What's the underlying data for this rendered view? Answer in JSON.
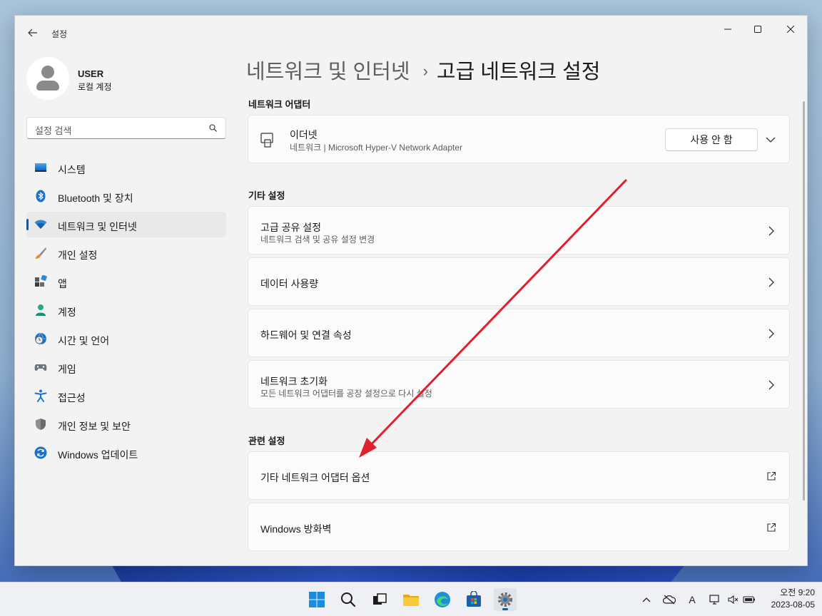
{
  "window": {
    "app_title": "설정"
  },
  "profile": {
    "name": "USER",
    "account_type": "로컬 계정"
  },
  "search": {
    "placeholder": "설정 검색"
  },
  "sidebar": {
    "items": [
      {
        "label": "시스템",
        "icon": "system-icon"
      },
      {
        "label": "Bluetooth 및 장치",
        "icon": "bluetooth-icon"
      },
      {
        "label": "네트워크 및 인터넷",
        "icon": "wifi-icon",
        "active": true
      },
      {
        "label": "개인 설정",
        "icon": "brush-icon"
      },
      {
        "label": "앱",
        "icon": "apps-icon"
      },
      {
        "label": "계정",
        "icon": "person-icon"
      },
      {
        "label": "시간 및 언어",
        "icon": "globe-clock-icon"
      },
      {
        "label": "게임",
        "icon": "gamepad-icon"
      },
      {
        "label": "접근성",
        "icon": "accessibility-icon"
      },
      {
        "label": "개인 정보 및 보안",
        "icon": "shield-icon"
      },
      {
        "label": "Windows 업데이트",
        "icon": "update-icon"
      }
    ]
  },
  "breadcrumb": {
    "parent": "네트워크 및 인터넷",
    "separator": "›",
    "current": "고급 네트워크 설정"
  },
  "adapters": {
    "title": "네트워크 어댑터",
    "ethernet": {
      "name": "이더넷",
      "description": "네트워크 | Microsoft Hyper-V Network Adapter",
      "button": "사용 안 함"
    }
  },
  "other_settings": {
    "title": "기타 설정",
    "items": [
      {
        "title": "고급 공유 설정",
        "subtitle": "네트워크 검색 및 공유 설정 변경"
      },
      {
        "title": "데이터 사용량"
      },
      {
        "title": "하드웨어 및 연결 속성"
      },
      {
        "title": "네트워크 초기화",
        "subtitle": "모든 네트워크 어댑터를 공장 설정으로 다시 설정"
      }
    ]
  },
  "related_settings": {
    "title": "관련 설정",
    "items": [
      {
        "title": "기타 네트워크 어댑터 옵션"
      },
      {
        "title": "Windows 방화벽"
      }
    ]
  },
  "taskbar": {
    "clock_ampm_time": "오전 9:20",
    "date": "2023-08-05",
    "ime_indicator": "A"
  },
  "colors": {
    "accent": "#005fb8",
    "annotation_arrow": "#e0202a"
  }
}
